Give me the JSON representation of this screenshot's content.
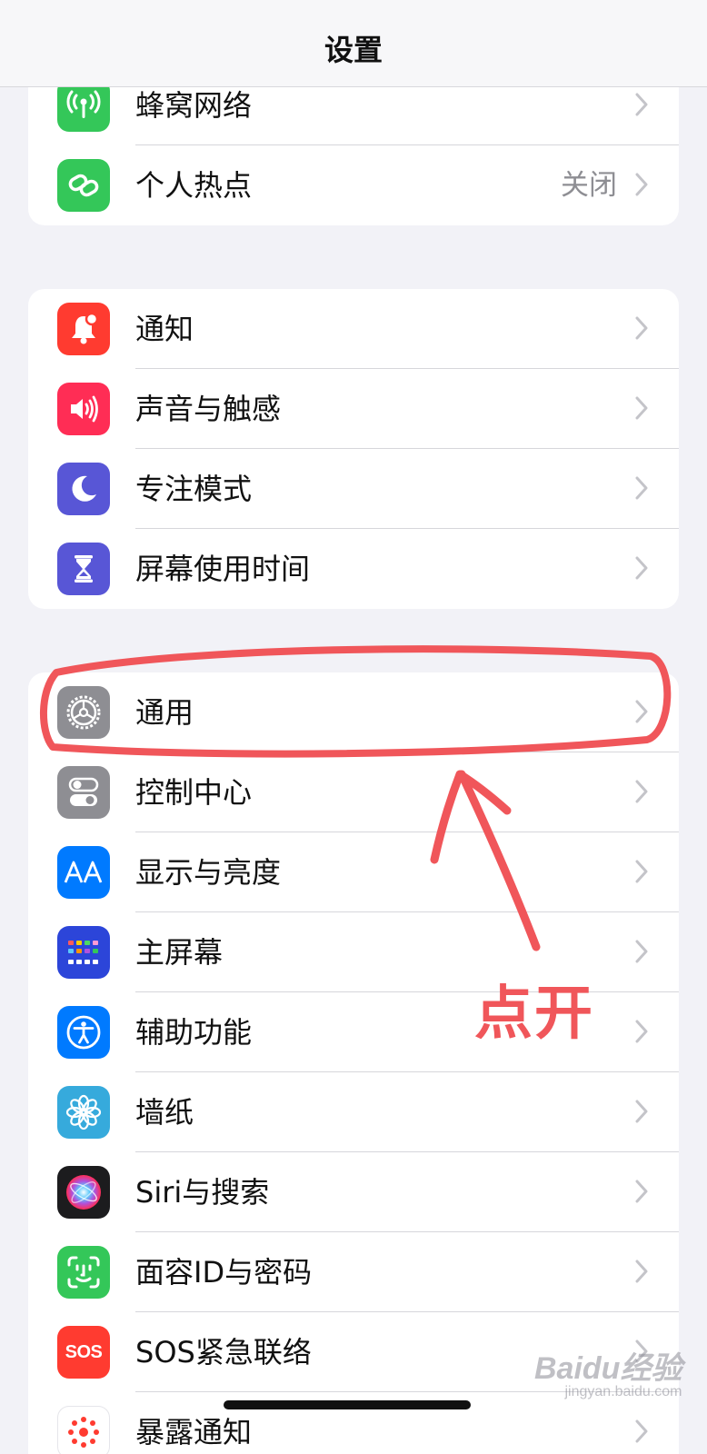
{
  "nav": {
    "title": "设置"
  },
  "group1": [
    {
      "label": "蜂窝网络",
      "icon": "cellular-antenna-icon",
      "color": "#34c759"
    },
    {
      "label": "个人热点",
      "value": "关闭",
      "icon": "hotspot-link-icon",
      "color": "#34c759"
    }
  ],
  "group2": [
    {
      "label": "通知",
      "icon": "notification-bell-icon",
      "color": "#ff3b30"
    },
    {
      "label": "声音与触感",
      "icon": "speaker-icon",
      "color": "#ff2d55"
    },
    {
      "label": "专注模式",
      "icon": "moon-icon",
      "color": "#5856d6"
    },
    {
      "label": "屏幕使用时间",
      "icon": "hourglass-icon",
      "color": "#5856d6"
    }
  ],
  "group3": [
    {
      "label": "通用",
      "icon": "gear-icon",
      "color": "#8e8e93"
    },
    {
      "label": "控制中心",
      "icon": "toggles-icon",
      "color": "#8e8e93"
    },
    {
      "label": "显示与亮度",
      "icon": "text-size-aa-icon",
      "color": "#007aff"
    },
    {
      "label": "主屏幕",
      "icon": "home-screen-grid-icon",
      "color": "#2c45d9"
    },
    {
      "label": "辅助功能",
      "icon": "accessibility-person-icon",
      "color": "#007aff"
    },
    {
      "label": "墙纸",
      "icon": "flower-icon",
      "color": "#36aadc"
    },
    {
      "label": "Siri与搜索",
      "icon": "siri-orb-icon",
      "color": "#1c1c1e"
    },
    {
      "label": "面容ID与密码",
      "icon": "face-id-icon",
      "color": "#34c759"
    },
    {
      "label": "SOS紧急联络",
      "icon": "sos-icon",
      "color": "#ff3b30",
      "icon_text": "SOS"
    },
    {
      "label": "暴露通知",
      "icon": "exposure-notification-icon",
      "color": "#ffffff"
    }
  ],
  "annotation": {
    "text": "点开",
    "color": "#f0565a"
  },
  "watermark": {
    "main": "Baidu经验",
    "sub": "jingyan.baidu.com"
  }
}
